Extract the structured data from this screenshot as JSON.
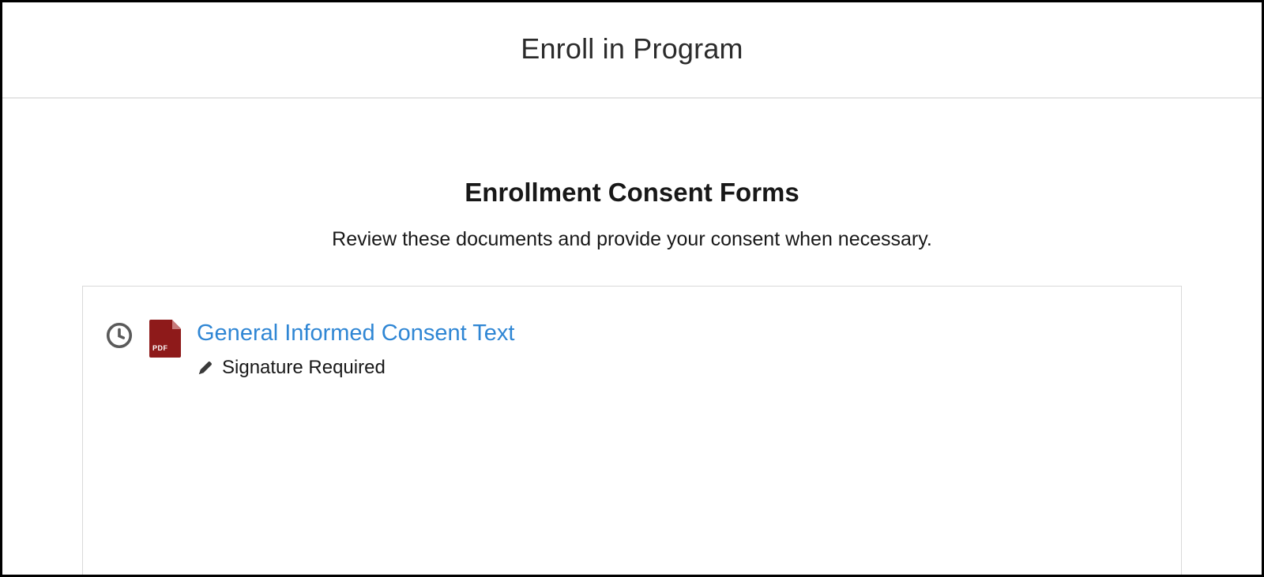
{
  "header": {
    "title": "Enroll in Program"
  },
  "section": {
    "title": "Enrollment Consent Forms",
    "subtitle": "Review these documents and provide your consent when necessary."
  },
  "documents": [
    {
      "file_badge": "PDF",
      "title": "General Informed Consent Text",
      "status": "Signature Required"
    }
  ],
  "colors": {
    "link": "#2f86d4",
    "pdf_body": "#8e1a1a",
    "pdf_fold": "#c77b7b",
    "border": "#d9d9d9"
  }
}
